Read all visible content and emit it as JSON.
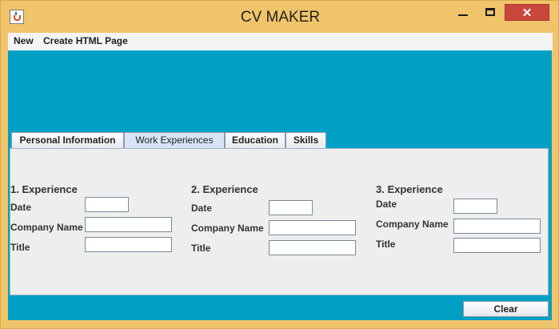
{
  "window": {
    "title": "CV MAKER",
    "close_glyph": "✕"
  },
  "menu": {
    "items": [
      "New",
      "Create HTML Page"
    ]
  },
  "tabs": [
    "Personal Information",
    "Work Experiences",
    "Education",
    "Skills"
  ],
  "active_tab": "Work Experiences",
  "experiences": [
    {
      "heading": "1. Experience",
      "date_label": "Date",
      "company_label": "Company Name",
      "title_label": "Title",
      "date": "",
      "company": "",
      "title": ""
    },
    {
      "heading": "2. Experience",
      "date_label": "Date",
      "company_label": "Company Name",
      "title_label": "Title",
      "date": "",
      "company": "",
      "title": ""
    },
    {
      "heading": "3. Experience",
      "date_label": "Date",
      "company_label": "Company Name",
      "title_label": "Title",
      "date": "",
      "company": "",
      "title": ""
    }
  ],
  "buttons": {
    "clear": "Clear"
  },
  "colors": {
    "accent": "#00a0c4",
    "window_frame": "#f0c46a",
    "close": "#c9463d"
  }
}
